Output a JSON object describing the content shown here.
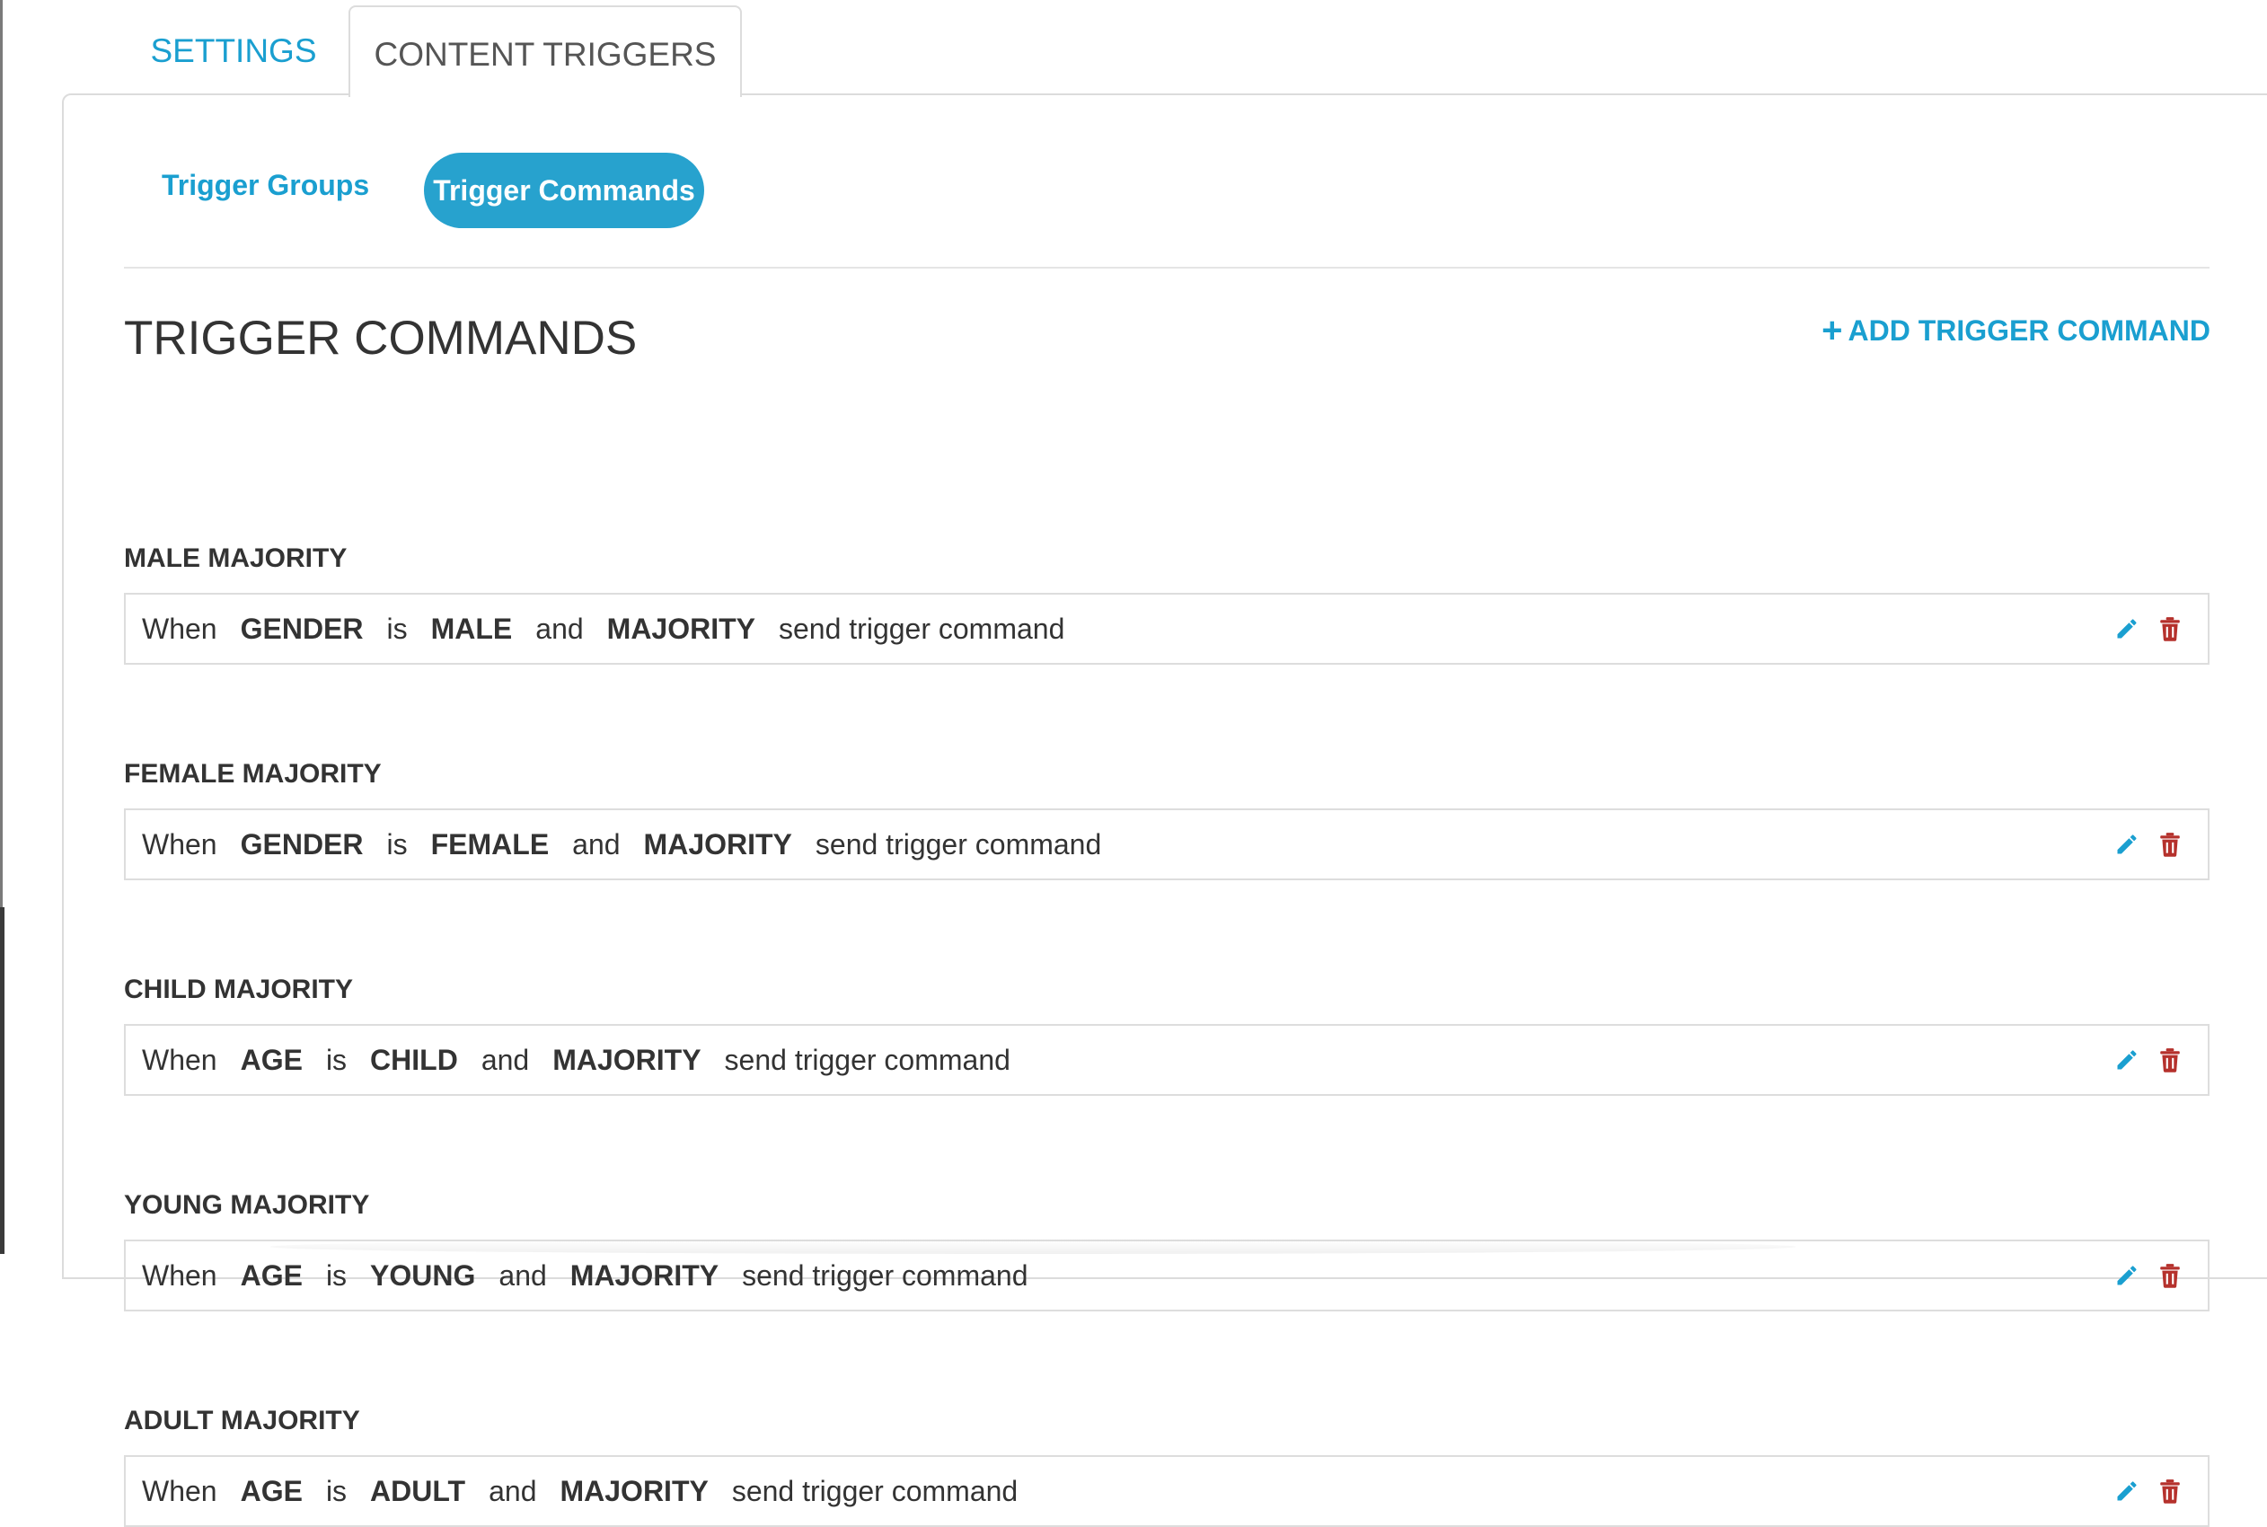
{
  "tabs": {
    "settings": "SETTINGS",
    "content_triggers": "CONTENT TRIGGERS"
  },
  "subtabs": {
    "groups": "Trigger Groups",
    "commands": "Trigger Commands"
  },
  "page_title": "TRIGGER COMMANDS",
  "add_button": {
    "icon": "+",
    "label": "ADD TRIGGER COMMAND"
  },
  "colors": {
    "accent": "#1a9fd0",
    "pill": "#27a2ce",
    "edit_icon": "#1a9fd0",
    "delete_icon": "#b5312c"
  },
  "icons": {
    "edit": "pencil-icon",
    "delete": "trash-icon"
  },
  "triggers": [
    {
      "title": "MALE MAJORITY",
      "when": "When",
      "field": "GENDER",
      "is": "is",
      "value": "MALE",
      "and": "and",
      "condition": "MAJORITY",
      "action": "send trigger command"
    },
    {
      "title": "FEMALE MAJORITY",
      "when": "When",
      "field": "GENDER",
      "is": "is",
      "value": "FEMALE",
      "and": "and",
      "condition": "MAJORITY",
      "action": "send trigger command"
    },
    {
      "title": "CHILD MAJORITY",
      "when": "When",
      "field": "AGE",
      "is": "is",
      "value": "CHILD",
      "and": "and",
      "condition": "MAJORITY",
      "action": "send trigger command"
    },
    {
      "title": "YOUNG MAJORITY",
      "when": "When",
      "field": "AGE",
      "is": "is",
      "value": "YOUNG",
      "and": "and",
      "condition": "MAJORITY",
      "action": "send trigger command"
    },
    {
      "title": "ADULT MAJORITY",
      "when": "When",
      "field": "AGE",
      "is": "is",
      "value": "ADULT",
      "and": "and",
      "condition": "MAJORITY",
      "action": "send trigger command"
    }
  ]
}
